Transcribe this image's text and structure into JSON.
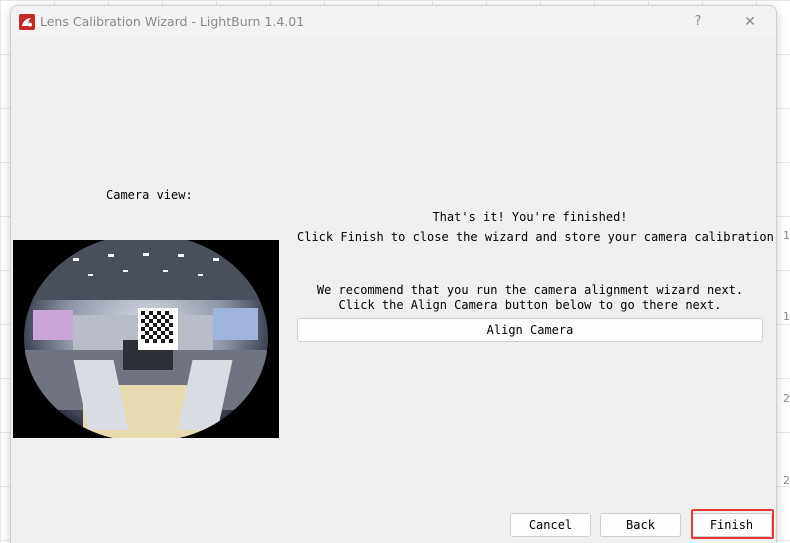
{
  "background": {
    "ruler_numbers": [
      "1",
      "1",
      "2",
      "2"
    ]
  },
  "window": {
    "title": "Lens Calibration Wizard - LightBurn 1.4.01",
    "help_label": "?",
    "close_label": "✕",
    "icon": "lightburn-logo-icon"
  },
  "camera": {
    "label": "Camera view:"
  },
  "messages": {
    "finished": "That's it!  You're finished!",
    "instruction": "Click Finish to close the wizard and store your camera calibration",
    "recommend": "We recommend that you run the camera alignment wizard next.",
    "align_hint": "Click the Align Camera button below to go there next."
  },
  "buttons": {
    "align_camera": "Align Camera",
    "cancel": "Cancel",
    "back": "Back",
    "finish": "Finish"
  },
  "colors": {
    "highlight": "#e53935",
    "window_bg": "#f0f0f0",
    "logo_red": "#c62828"
  }
}
